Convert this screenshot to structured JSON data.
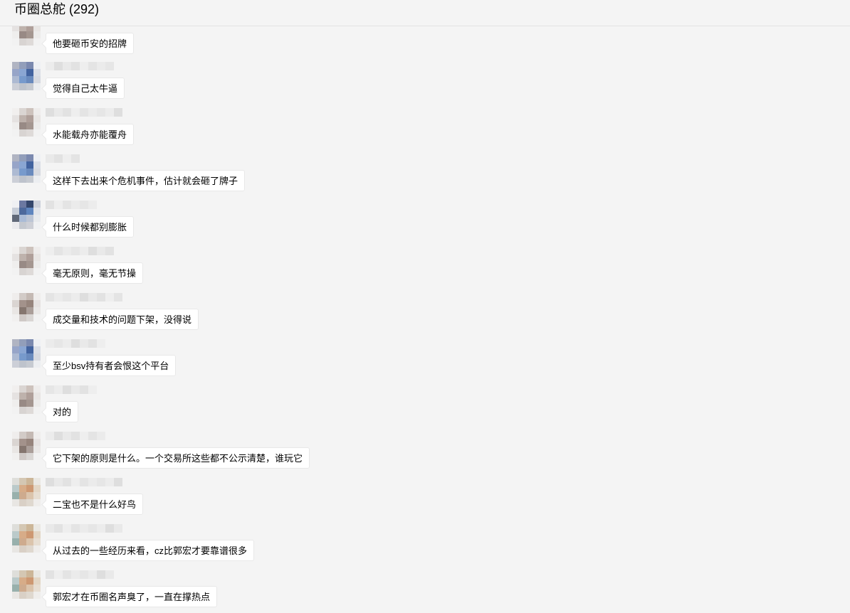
{
  "header": {
    "title": "币圈总舵 (292)"
  },
  "messages": [
    {
      "text": "他要砸币安的招牌",
      "avatar": "gray-brown"
    },
    {
      "text": "觉得自己太牛逼",
      "avatar": "blue"
    },
    {
      "text": "水能载舟亦能覆舟",
      "avatar": "gray-brown"
    },
    {
      "text": "这样下去出来个危机事件，估计就会砸了牌子",
      "avatar": "blue"
    },
    {
      "text": "什么时候都别膨胀",
      "avatar": "blue-dark"
    },
    {
      "text": "毫无原则，毫无节操",
      "avatar": "gray-brown"
    },
    {
      "text": "成交量和技术的问题下架，没得说",
      "avatar": "brown"
    },
    {
      "text": "至少bsv持有者会恨这个平台",
      "avatar": "blue"
    },
    {
      "text": "对的",
      "avatar": "gray-brown"
    },
    {
      "text": "它下架的原则是什么。一个交易所这些都不公示清楚，谁玩它",
      "avatar": "brown"
    },
    {
      "text": "二宝也不是什么好鸟",
      "avatar": "tan"
    },
    {
      "text": "从过去的一些经历来看，cz比郭宏才要靠谱很多",
      "avatar": "tan"
    },
    {
      "text": "郭宏才在币圈名声臭了，一直在撑热点",
      "avatar": "tan"
    }
  ]
}
